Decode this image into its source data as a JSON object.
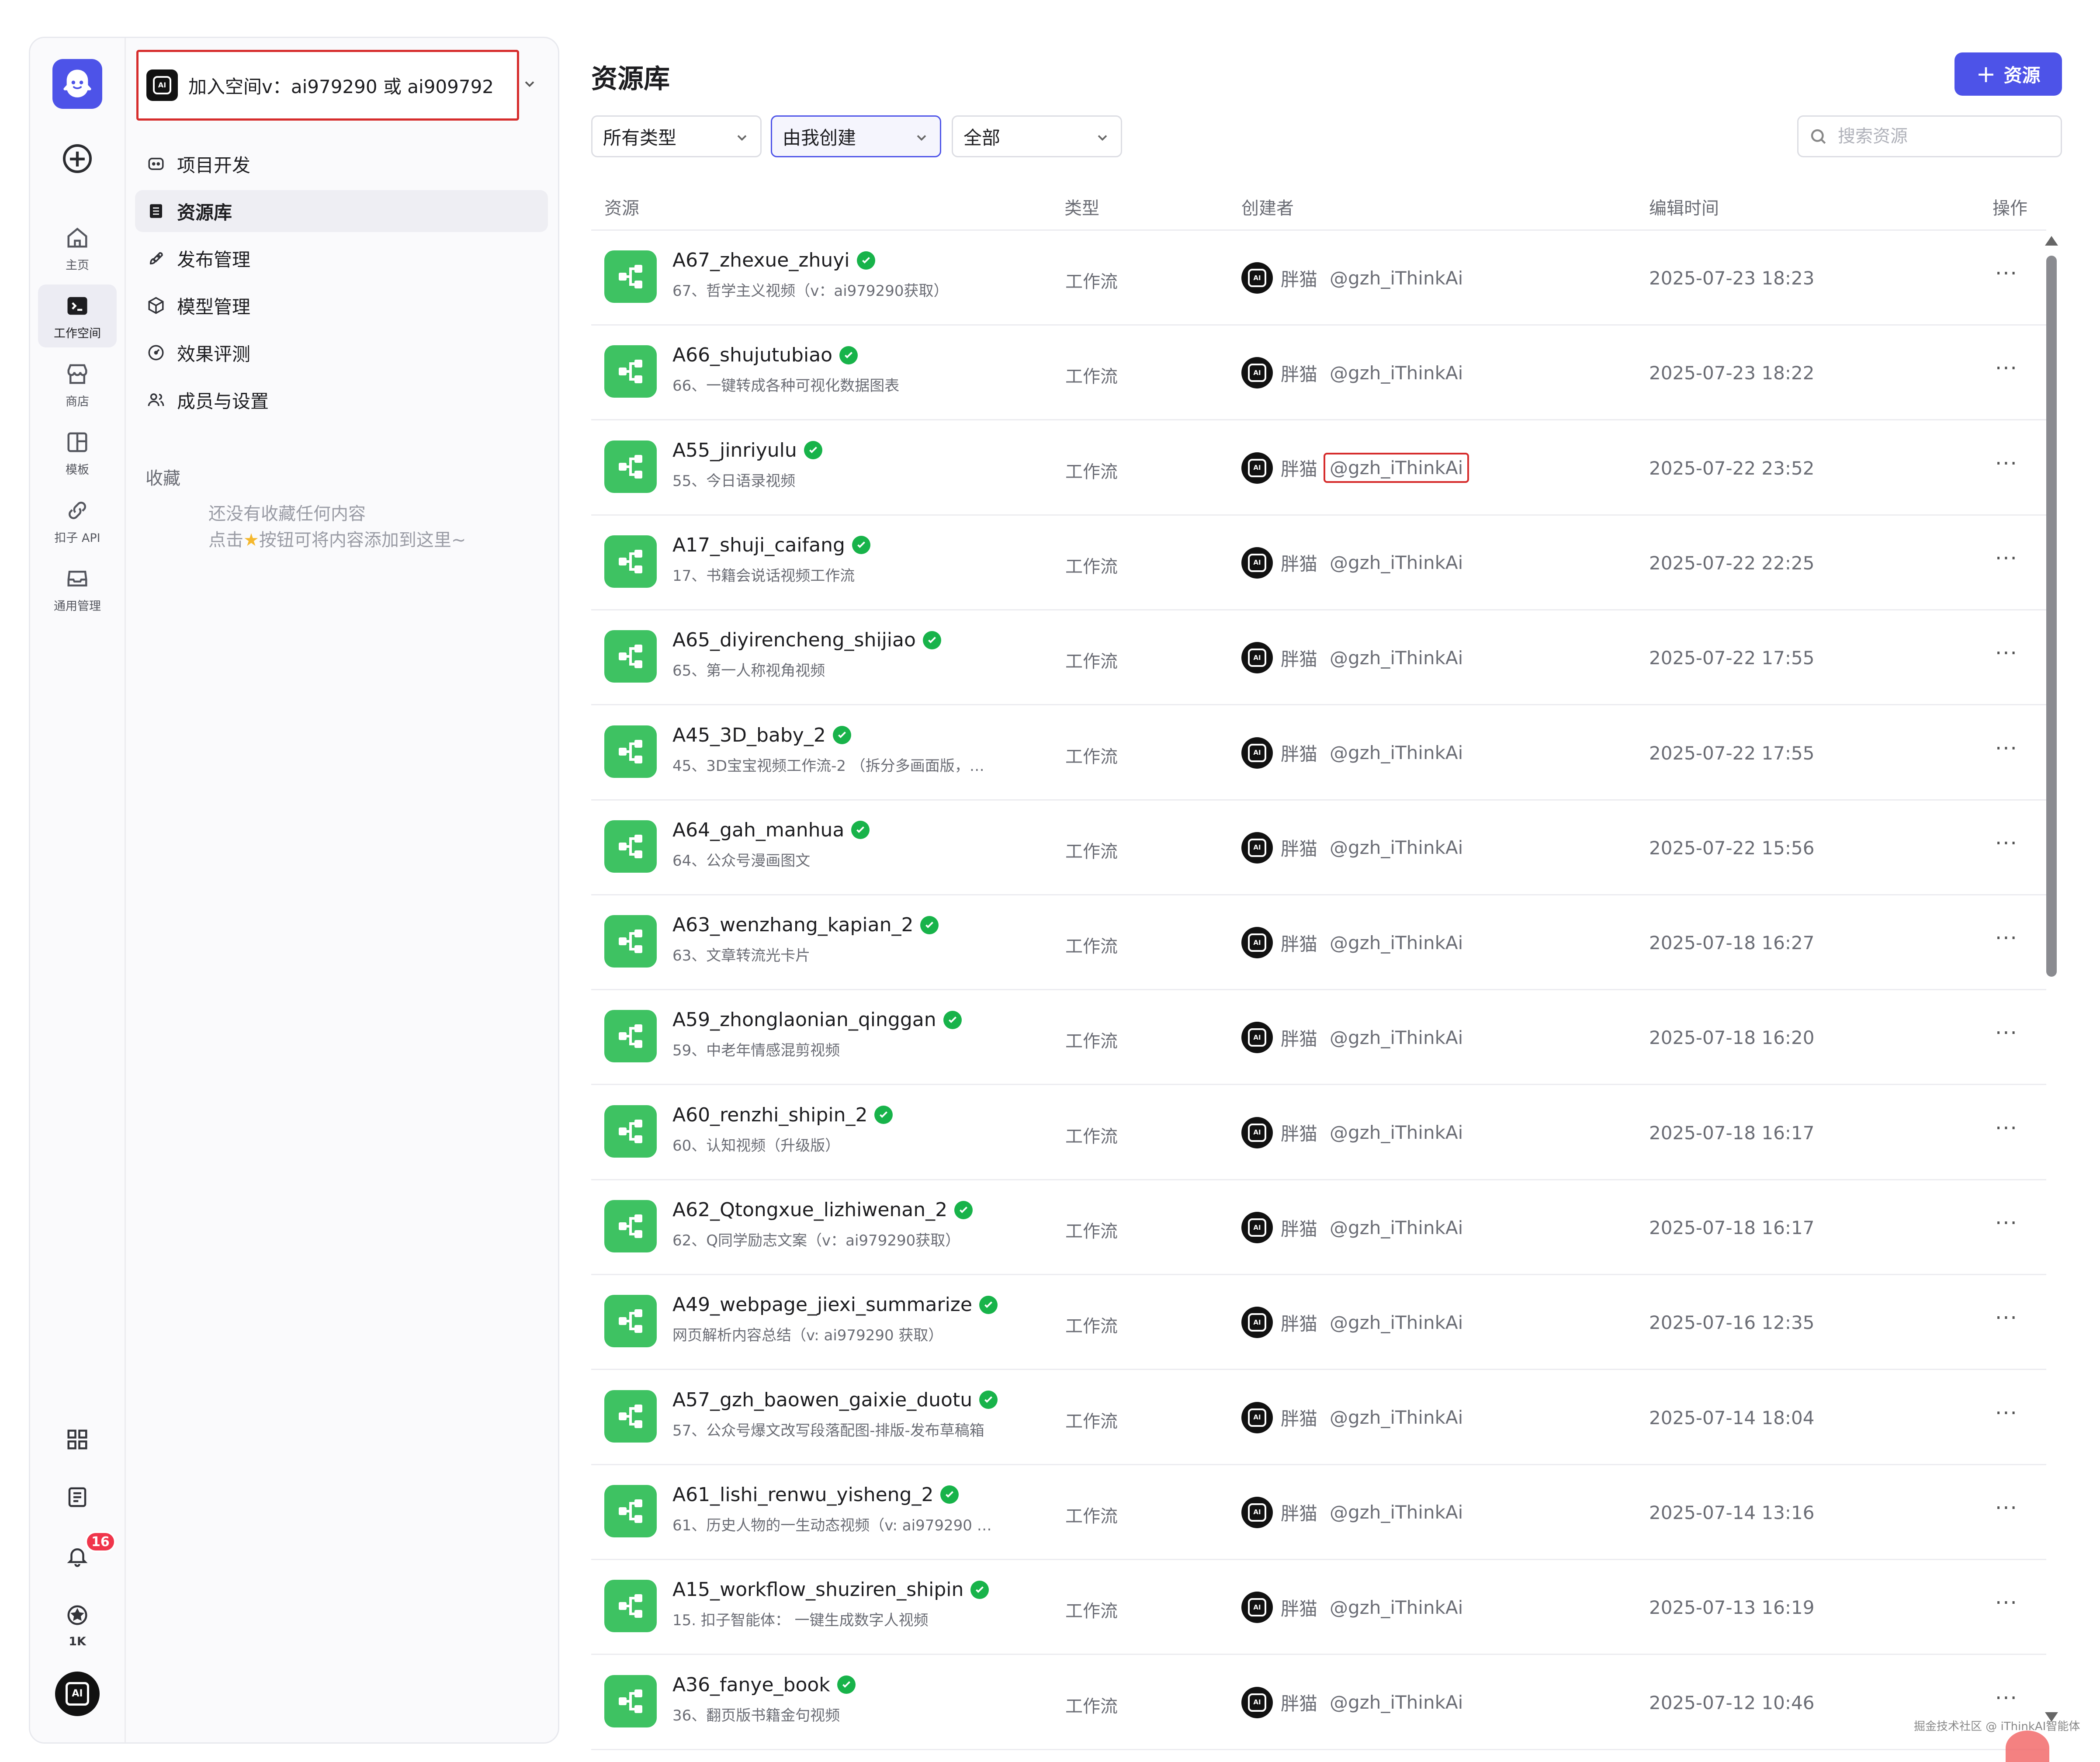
{
  "rail": {
    "items": [
      {
        "label": "主页",
        "icon": "home-icon"
      },
      {
        "label": "工作空间",
        "icon": "terminal-icon"
      },
      {
        "label": "商店",
        "icon": "store-icon"
      },
      {
        "label": "模板",
        "icon": "template-icon"
      },
      {
        "label": "扣子 API",
        "icon": "api-icon"
      },
      {
        "label": "通用管理",
        "icon": "inbox-icon"
      }
    ],
    "notification_count": "16",
    "points": "1K",
    "avatar_text": "AI"
  },
  "sidebar": {
    "space_name": "加入空间v：ai979290 或 ai909792",
    "nav": [
      {
        "label": "项目开发",
        "icon": "project-icon"
      },
      {
        "label": "资源库",
        "icon": "library-icon",
        "active": true
      },
      {
        "label": "发布管理",
        "icon": "rocket-icon"
      },
      {
        "label": "模型管理",
        "icon": "model-icon"
      },
      {
        "label": "效果评测",
        "icon": "gauge-icon"
      },
      {
        "label": "成员与设置",
        "icon": "members-icon"
      }
    ],
    "favorites_title": "收藏",
    "favorites_empty_line1": "还没有收藏任何内容",
    "favorites_empty_line2_a": "点击",
    "favorites_empty_line2_b": "按钮可将内容添加到这里~"
  },
  "main": {
    "title": "资源库",
    "add_button": "资源",
    "filters": {
      "type": "所有类型",
      "creator": "由我创建",
      "status": "全部"
    },
    "search_placeholder": "搜索资源",
    "columns": {
      "resource": "资源",
      "type": "类型",
      "creator": "创建者",
      "edited": "编辑时间",
      "actions": "操作"
    },
    "rows": [
      {
        "name": "A67_zhexue_zhuyi",
        "desc": "67、哲学主义视频（v：ai979290获取）",
        "type": "工作流",
        "creator": "胖猫",
        "handle": "@gzh_iThinkAi",
        "time": "2025-07-23 18:23"
      },
      {
        "name": "A66_shujutubiao",
        "desc": "66、一键转成各种可视化数据图表",
        "type": "工作流",
        "creator": "胖猫",
        "handle": "@gzh_iThinkAi",
        "time": "2025-07-23 18:22"
      },
      {
        "name": "A55_jinriyulu",
        "desc": "55、今日语录视频",
        "type": "工作流",
        "creator": "胖猫",
        "handle": "@gzh_iThinkAi",
        "time": "2025-07-22 23:52"
      },
      {
        "name": "A17_shuji_caifang",
        "desc": "17、书籍会说话视频工作流",
        "type": "工作流",
        "creator": "胖猫",
        "handle": "@gzh_iThinkAi",
        "time": "2025-07-22 22:25"
      },
      {
        "name": "A65_diyirencheng_shijiao",
        "desc": "65、第一人称视角视频",
        "type": "工作流",
        "creator": "胖猫",
        "handle": "@gzh_iThinkAi",
        "time": "2025-07-22 17:55"
      },
      {
        "name": "A45_3D_baby_2",
        "desc": "45、3D宝宝视频工作流-2 （拆分多画面版，…",
        "type": "工作流",
        "creator": "胖猫",
        "handle": "@gzh_iThinkAi",
        "time": "2025-07-22 17:55"
      },
      {
        "name": "A64_gah_manhua",
        "desc": "64、公众号漫画图文",
        "type": "工作流",
        "creator": "胖猫",
        "handle": "@gzh_iThinkAi",
        "time": "2025-07-22 15:56"
      },
      {
        "name": "A63_wenzhang_kapian_2",
        "desc": "63、文章转流光卡片",
        "type": "工作流",
        "creator": "胖猫",
        "handle": "@gzh_iThinkAi",
        "time": "2025-07-18 16:27"
      },
      {
        "name": "A59_zhonglaonian_qinggan",
        "desc": "59、中老年情感混剪视频",
        "type": "工作流",
        "creator": "胖猫",
        "handle": "@gzh_iThinkAi",
        "time": "2025-07-18 16:20"
      },
      {
        "name": "A60_renzhi_shipin_2",
        "desc": "60、认知视频（升级版）",
        "type": "工作流",
        "creator": "胖猫",
        "handle": "@gzh_iThinkAi",
        "time": "2025-07-18 16:17"
      },
      {
        "name": "A62_Qtongxue_lizhiwenan_2",
        "desc": "62、Q同学励志文案（v：ai979290获取）",
        "type": "工作流",
        "creator": "胖猫",
        "handle": "@gzh_iThinkAi",
        "time": "2025-07-18 16:17"
      },
      {
        "name": "A49_webpage_jiexi_summarize",
        "desc": "网页解析内容总结（v: ai979290 获取）",
        "type": "工作流",
        "creator": "胖猫",
        "handle": "@gzh_iThinkAi",
        "time": "2025-07-16 12:35"
      },
      {
        "name": "A57_gzh_baowen_gaixie_duotu",
        "desc": "57、公众号爆文改写段落配图-排版-发布草稿箱",
        "type": "工作流",
        "creator": "胖猫",
        "handle": "@gzh_iThinkAi",
        "time": "2025-07-14 18:04"
      },
      {
        "name": "A61_lishi_renwu_yisheng_2",
        "desc": "61、历史人物的一生动态视频（v: ai979290 …",
        "type": "工作流",
        "creator": "胖猫",
        "handle": "@gzh_iThinkAi",
        "time": "2025-07-14 13:16"
      },
      {
        "name": "A15_workflow_shuziren_shipin",
        "desc": "15. 扣子智能体： 一键生成数字人视频",
        "type": "工作流",
        "creator": "胖猫",
        "handle": "@gzh_iThinkAi",
        "time": "2025-07-13 16:19"
      },
      {
        "name": "A36_fanye_book",
        "desc": "36、翻页版书籍金句视频",
        "type": "工作流",
        "creator": "胖猫",
        "handle": "@gzh_iThinkAi",
        "time": "2025-07-12 10:46"
      }
    ],
    "more_label": "···"
  },
  "footer": {
    "watermark": "掘金技术社区 @ iThinkAI智能体"
  },
  "colors": {
    "brand": "#4d53e8",
    "workflow_icon": "#3ec262",
    "verified": "#18b34a",
    "highlight_box": "#d62c2c",
    "badge": "#f0354b"
  }
}
